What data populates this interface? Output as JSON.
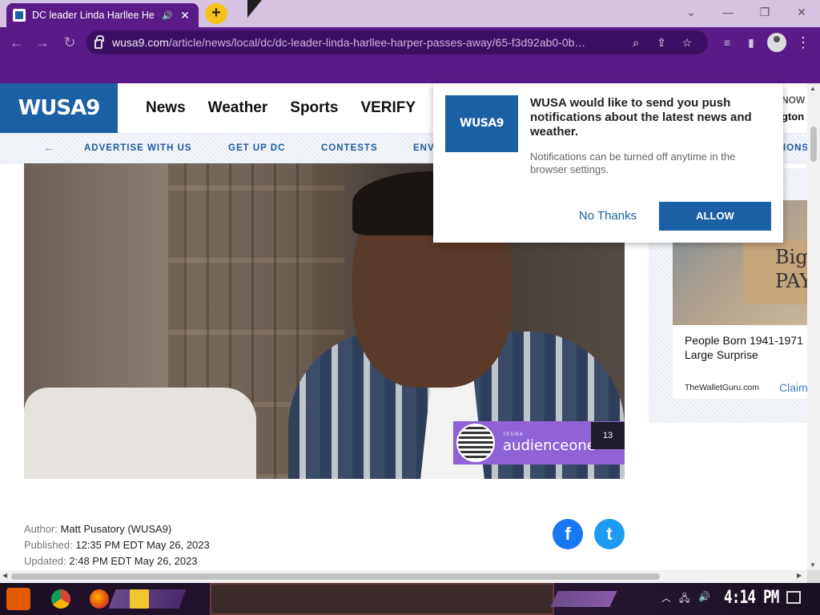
{
  "browser": {
    "tab_title": "DC leader Linda Harllee He",
    "url_host": "wusa9.com",
    "url_path": "/article/news/local/dc/dc-leader-linda-harllee-harper-passes-away/65-f3d92ab0-0b…",
    "new_tab_label": "+",
    "speaker_icon": "🔊",
    "close_label": "✕"
  },
  "site": {
    "logo_text": "WUSA9",
    "nav": [
      "News",
      "Weather",
      "Sports",
      "VERIFY"
    ],
    "nav_right_top": "NOW",
    "nav_right_bottom": "gton",
    "subnav": [
      "ADVERTISE WITH US",
      "GET UP DC",
      "CONTESTS",
      "ENV",
      "IONS"
    ]
  },
  "video": {
    "badge_small": "TEGNA",
    "badge_text": "audienceone",
    "count": "13"
  },
  "byline": {
    "author_label": "Author:",
    "author": "Matt Pusatory (WUSA9)",
    "published_label": "Published:",
    "published": "12:35 PM EDT May 26, 2023",
    "updated_label": "Updated:",
    "updated": "2:48 PM EDT May 26, 2023"
  },
  "share": {
    "facebook": "f",
    "twitter": "t"
  },
  "ad": {
    "sign_text": "Big PAY",
    "caption_line1": "People Born 1941-1971",
    "caption_line2": "Large Surprise",
    "source": "TheWalletGuru.com",
    "cta": "Claim"
  },
  "popup": {
    "logo_text": "WUSA9",
    "title": "WUSA would like to send you push notifications about the latest news and weather.",
    "note": "Notifications can be turned off anytime in the browser settings.",
    "no_thanks": "No Thanks",
    "allow": "ALLOW"
  },
  "taskbar": {
    "clock": "4:14 PM"
  },
  "colors": {
    "brand_blue": "#1b5fa5",
    "browser_purple": "#5a1a87",
    "tab_new_yellow": "#f6c21a"
  }
}
